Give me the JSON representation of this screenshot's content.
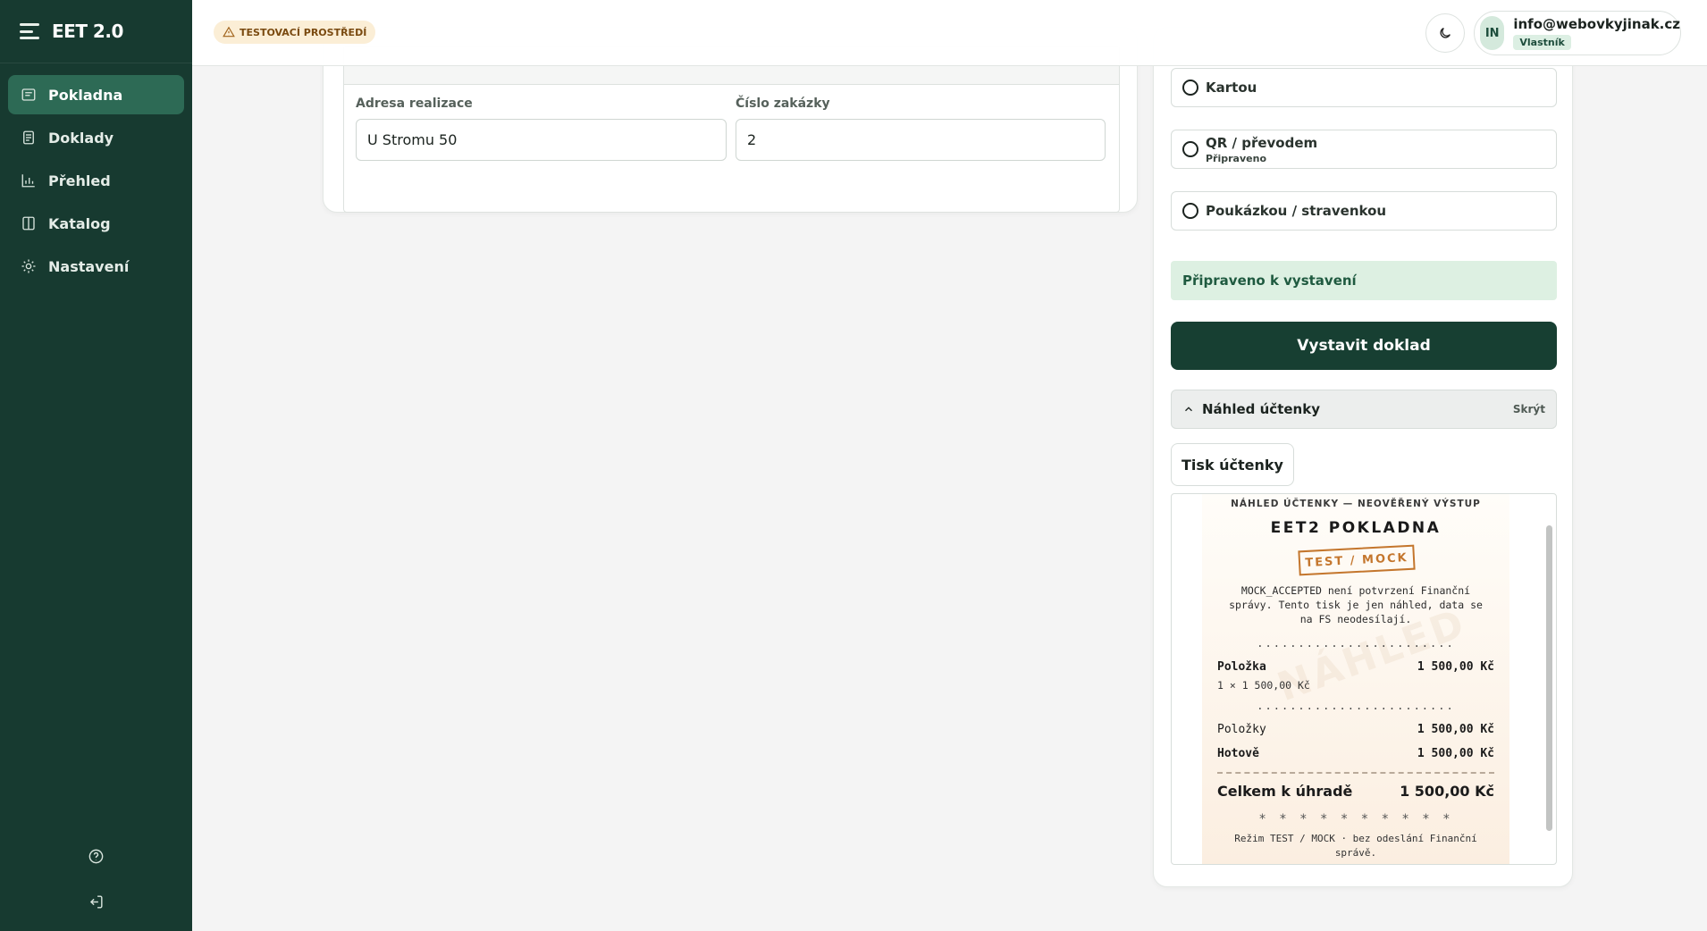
{
  "app": {
    "name": "EET 2.0"
  },
  "sidebar": {
    "items": [
      {
        "label": "Pokladna",
        "icon": "receipt-icon",
        "active": true
      },
      {
        "label": "Doklady",
        "icon": "document-icon"
      },
      {
        "label": "Přehled",
        "icon": "bar-chart-icon"
      },
      {
        "label": "Katalog",
        "icon": "book-icon"
      },
      {
        "label": "Nastavení",
        "icon": "sun-settings-icon"
      }
    ],
    "help_icon": "help-circle-icon",
    "logout_icon": "logout-icon"
  },
  "header": {
    "env_badge": "TESTOVACÍ PROSTŘEDÍ",
    "theme_icon": "moon-icon",
    "user": {
      "initials": "IN",
      "email": "info@webovkyjinak.cz",
      "role": "Vlastník"
    }
  },
  "form": {
    "address_label": "Adresa realizace",
    "address_value": "U Stromu 50",
    "order_label": "Číslo zakázky",
    "order_value": "2"
  },
  "payment": {
    "options": [
      {
        "label": "Kartou",
        "sub": ""
      },
      {
        "label": "QR / převodem",
        "sub": "Připraveno"
      },
      {
        "label": "Poukázkou / stravenkou",
        "sub": ""
      }
    ],
    "status": "Připraveno k vystavení",
    "issue_button": "Vystavit doklad",
    "preview_title": "Náhled účtenky",
    "hide_label": "Skrýt",
    "print_button": "Tisk účtenky"
  },
  "receipt": {
    "header": "NÁHLED ÚČTENKY — NEOVĚŘENÝ VÝSTUP",
    "title": "EET2 POKLADNA",
    "stamp": "TEST / MOCK",
    "note": "MOCK_ACCEPTED není potvrzení Finanční správy. Tento tisk je jen náhled, data se na FS neodesílají.",
    "dots": "........................",
    "watermark": "NÁHLED",
    "item_name": "Položka",
    "item_price": "1 500,00 Kč",
    "item_qty": "1 × 1 500,00 Kč",
    "subtotal_label": "Položky",
    "subtotal_value": "1 500,00 Kč",
    "cash_label": "Hotově",
    "cash_value": "1 500,00 Kč",
    "total_label": "Celkem k úhradě",
    "total_value": "1 500,00 Kč",
    "stars": "* * * * * * * * * *",
    "footer": "Režim TEST / MOCK · bez odeslání Finanční správě."
  },
  "colors": {
    "sidebar": "#173a30",
    "accent": "#2d6a55",
    "primary_button": "#173f32",
    "stamp": "#c4762d"
  }
}
